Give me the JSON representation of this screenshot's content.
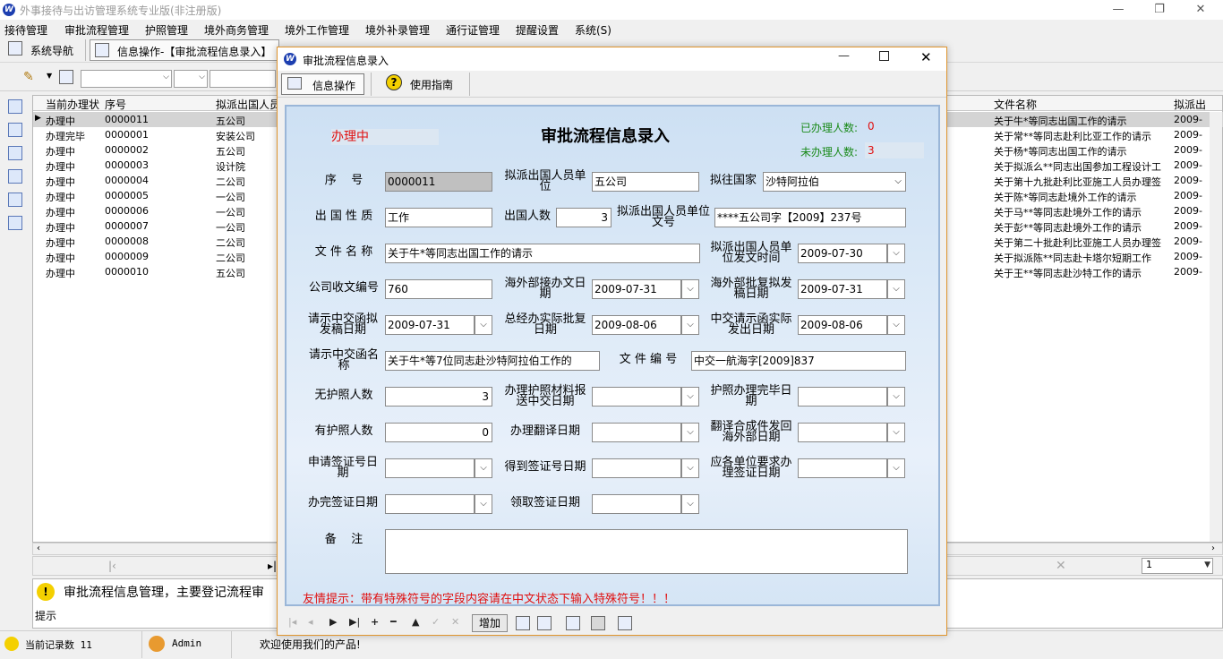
{
  "app": {
    "title": "外事接待与出访管理系统专业版(非注册版)",
    "menu": [
      "接待管理",
      "审批流程管理",
      "护照管理",
      "境外商务管理",
      "境外工作管理",
      "境外补录管理",
      "通行证管理",
      "提醒设置",
      "系统(S)"
    ],
    "nav_button": "系统导航",
    "doc_tab": "信息操作-【审批流程信息录入】"
  },
  "grid": {
    "headers": [
      "当前办理状",
      "序号",
      "拟派出国人员",
      "文件名称",
      "拟派出"
    ],
    "rows": [
      {
        "status": "办理中",
        "no": "0000011",
        "unit": "五公司",
        "file": "关于牛*等同志出国工作的请示",
        "d": "2009-"
      },
      {
        "status": "办理完毕",
        "no": "0000001",
        "unit": "安装公司",
        "file": "关于常**等同志赴利比亚工作的请示",
        "d": "2009-"
      },
      {
        "status": "办理中",
        "no": "0000002",
        "unit": " 五公司",
        "file": " 关于杨*等同志出国工作的请示",
        "d": "2009-"
      },
      {
        "status": "办理中",
        "no": "0000003",
        "unit": "设计院",
        "file": "关于拟派么**同志出国参加工程设计工",
        "d": "2009-"
      },
      {
        "status": "办理中",
        "no": "0000004",
        "unit": "二公司",
        "file": "关于第十九批赴利比亚施工人员办理签",
        "d": "2009-"
      },
      {
        "status": "办理中",
        "no": "0000005",
        "unit": "一公司",
        "file": "关于陈*等同志赴境外工作的请示",
        "d": "2009-"
      },
      {
        "status": "办理中",
        "no": "0000006",
        "unit": "一公司",
        "file": "关于马**等同志赴境外工作的请示",
        "d": "2009-"
      },
      {
        "status": "办理中",
        "no": "0000007",
        "unit": "一公司",
        "file": "关于彭**等同志赴境外工作的请示",
        "d": "2009-"
      },
      {
        "status": "办理中",
        "no": "0000008",
        "unit": "二公司",
        "file": "关于第二十批赴利比亚施工人员办理签",
        "d": "2009-"
      },
      {
        "status": "办理中",
        "no": "0000009",
        "unit": "二公司",
        "file": "关于拟派陈**同志赴卡塔尔短期工作",
        "d": "2009-"
      },
      {
        "status": "办理中",
        "no": "0000010",
        "unit": "五公司",
        "file": "关于王**等同志赴沙特工作的请示",
        "d": "2009-"
      }
    ]
  },
  "pager": {
    "page_value": "1"
  },
  "hint": {
    "text": "审批流程信息管理，主要登记流程审",
    "label": "提示"
  },
  "status": {
    "records": "当前记录数 11",
    "user": "Admin",
    "welcome": "欢迎使用我们的产品!"
  },
  "dialog": {
    "title": "审批流程信息录入",
    "tab_info": "信息操作",
    "tab_guide": "使用指南",
    "form_title": "审批流程信息录入",
    "state": "办理中",
    "done_label": "已办理人数:",
    "done_value": "0",
    "todo_label": "未办理人数:",
    "todo_value": "3",
    "fields": {
      "seq_label": "序    号",
      "seq": "0000011",
      "unit_label": "拟派出国人员单位",
      "unit": "五公司",
      "country_label": "拟往国家",
      "country": "沙特阿拉伯",
      "nature_label": "出 国 性 质",
      "nature": "工作",
      "count_label": "出国人数",
      "count": "3",
      "unit_doc_label": "拟派出国人员单位文号",
      "unit_doc": "****五公司字【2009】237号",
      "file_label": "文 件 名 称",
      "file": "关于牛*等同志出国工作的请示",
      "send_time_label": "拟派出国人员单位发文时间",
      "send_time": "2009-07-30",
      "recv_label": "公司收文编号",
      "recv": "760",
      "overseas_recv_label": "海外部接办文日期",
      "overseas_recv": "2009-07-31",
      "overseas_draft_label": "海外部批复拟发稿日期",
      "overseas_draft": "2009-07-31",
      "req_draft_label": "请示中交函拟发稿日期",
      "req_draft": "2009-07-31",
      "gm_label": "总经办实际批复日期",
      "gm": "2009-08-06",
      "req_send_label": "中交请示函实际发出日期",
      "req_send": "2009-08-06",
      "req_name_label": "请示中交函名称",
      "req_name": "关于牛*等7位同志赴沙特阿拉伯工作的",
      "doc_no_label": "文 件 编 号",
      "doc_no": "中交一航海字[2009]837",
      "no_passport_label": "无护照人数",
      "no_passport": "3",
      "passport_send_label": "办理护照材料报送中交日期",
      "passport_send": "",
      "passport_done_label": "护照办理完毕日期",
      "passport_done": "",
      "has_passport_label": "有护照人数",
      "has_passport": "0",
      "translate_label": "办理翻译日期",
      "translate": "",
      "translate_send_label": "翻译合成件发回海外部日期",
      "translate_send": "",
      "visa_apply_label": "申请签证号日期",
      "visa_apply": "",
      "visa_got_label": "得到签证号日期",
      "visa_got": "",
      "visa_req_label": "应各单位要求办理签证日期",
      "visa_req": "",
      "visa_done_label": "办完签证日期",
      "visa_done": "",
      "visa_take_label": "领取签证日期",
      "visa_take": "",
      "remark_label": "备    注",
      "remark": ""
    },
    "tip": "友情提示：带有特殊符号的字段内容请在中文状态下输入特殊符号！！！",
    "add_button": "增加"
  },
  "colors": {
    "accent_red": "#e01010",
    "label_green": "#1a8a1a",
    "dialog_border": "#e0952e"
  }
}
